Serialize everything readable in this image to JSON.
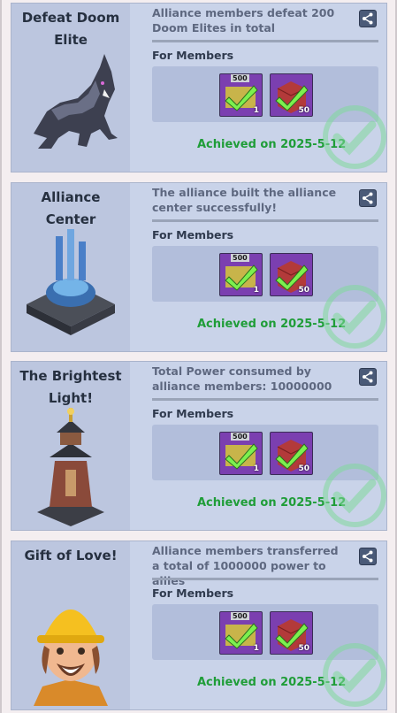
{
  "achievements": [
    {
      "title": "Defeat Doom Elite",
      "description": "Alliance members defeat 200 Doom Elites in total",
      "members_label": "For Members",
      "rewards": [
        {
          "tag": "500",
          "qty": "1"
        },
        {
          "tag": "",
          "qty": "50"
        }
      ],
      "achieved": "Achieved on 2025-5-12",
      "art": "wolf-creature"
    },
    {
      "title": "Alliance Center",
      "description": "The alliance built the alliance center successfully!",
      "members_label": "For Members",
      "rewards": [
        {
          "tag": "500",
          "qty": "1"
        },
        {
          "tag": "",
          "qty": "50"
        }
      ],
      "achieved": "Achieved on 2025-5-12",
      "art": "alliance-center-building"
    },
    {
      "title": "The Brightest Light!",
      "description": "Total Power consumed by alliance members: 10000000",
      "members_label": "For Members",
      "rewards": [
        {
          "tag": "500",
          "qty": "1"
        },
        {
          "tag": "",
          "qty": "50"
        }
      ],
      "achieved": "Achieved on 2025-5-12",
      "art": "tower"
    },
    {
      "title": "Gift of Love!",
      "description": "Alliance members transferred a total of 1000000 power to allies",
      "members_label": "For Members",
      "rewards": [
        {
          "tag": "500",
          "qty": "1"
        },
        {
          "tag": "",
          "qty": "50"
        }
      ],
      "achieved": "Achieved on 2025-5-12",
      "art": "builder-character"
    }
  ],
  "colors": {
    "achieved_text": "#1f9d38",
    "reward_bg": "#7b3fb0",
    "card_bg": "#c9d3e9"
  }
}
